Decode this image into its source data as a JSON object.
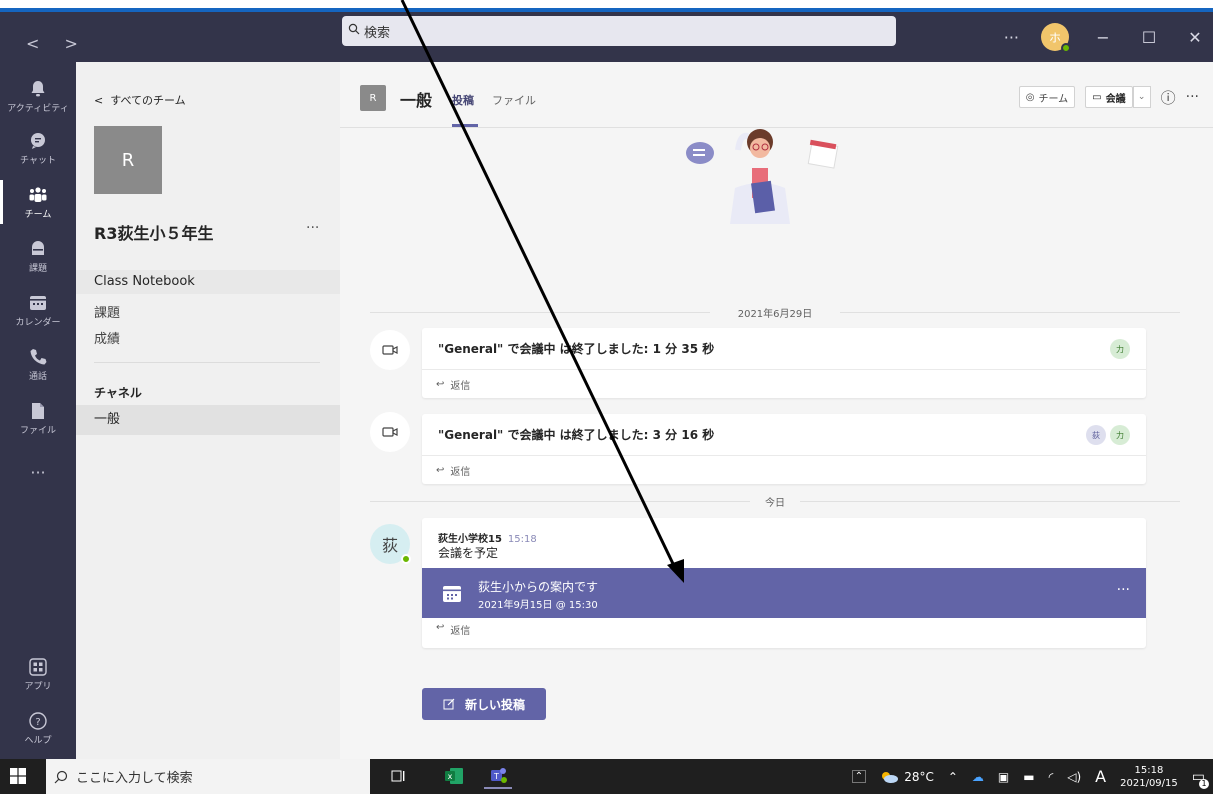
{
  "titlebar": {
    "search_placeholder": "検索",
    "more": "···",
    "avatar_initial": "ホ",
    "status_color": "#6bb700"
  },
  "rail": [
    {
      "label": "アクティビティ",
      "icon": "bell-icon"
    },
    {
      "label": "チャット",
      "icon": "chat-icon"
    },
    {
      "label": "チーム",
      "icon": "teams-icon"
    },
    {
      "label": "課題",
      "icon": "assignments-icon"
    },
    {
      "label": "カレンダー",
      "icon": "calendar-icon"
    },
    {
      "label": "通話",
      "icon": "phone-icon"
    },
    {
      "label": "ファイル",
      "icon": "file-icon"
    },
    {
      "label": "···",
      "icon": "more-icon"
    },
    {
      "label": "アプリ",
      "icon": "apps-icon"
    },
    {
      "label": "ヘルプ",
      "icon": "help-icon"
    }
  ],
  "team_pane": {
    "back_label": "すべてのチーム",
    "tile_initial": "R",
    "team_name": "R3荻生小５年生",
    "more": "···",
    "notebook": "Class Notebook",
    "links": [
      "課題",
      "成績"
    ],
    "channels_heading": "チャネル",
    "channel": "一般"
  },
  "channel": {
    "badge": "R",
    "name": "一般",
    "tabs": [
      "投稿",
      "ファイル"
    ],
    "team_button": "チーム",
    "meet_button": "会議",
    "info": "ⓘ",
    "more": "···"
  },
  "feed": {
    "date1": "2021年6月29日",
    "meeting1": {
      "text": "\"General\" で会議中 は終了しました: 1 分 35 秒",
      "avatars": [
        "力"
      ]
    },
    "meeting2": {
      "text": "\"General\" で会議中 は終了しました: 3 分 16 秒",
      "avatars": [
        "荻",
        "力"
      ]
    },
    "reply_label": "返信",
    "date2": "今日",
    "post": {
      "avatar": "荻",
      "author": "荻生小学校15",
      "time": "15:18",
      "message": "会議を予定",
      "card_title": "荻生小からの案内です",
      "card_datetime": "2021年9月15日 @ 15:30",
      "card_more": "···",
      "card_color": "#6264a7"
    },
    "new_post": "新しい投稿"
  },
  "taskbar": {
    "search": "ここに入力して検索",
    "weather": "28°C",
    "ime": "A",
    "time": "15:18",
    "date": "2021/09/15",
    "notifications": "1"
  }
}
